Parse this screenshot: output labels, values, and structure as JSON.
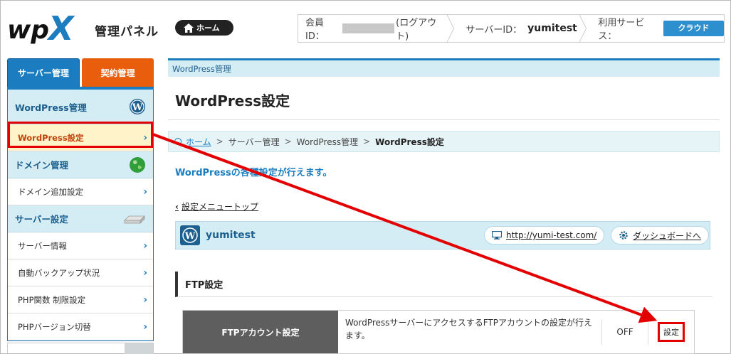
{
  "header": {
    "logo_text": "管理パネル",
    "home_label": "ホーム",
    "member_id_label": "会員ID：",
    "logout_label": "(ログアウト)",
    "server_id_label": "サーバーID：",
    "server_id_value": "yumitest",
    "service_label": "利用サービス：",
    "service_value": "クラウド"
  },
  "sidebar": {
    "tab_server": "サーバー管理",
    "tab_contract": "契約管理",
    "sections": [
      {
        "heading": "WordPress管理",
        "items": [
          "WordPress設定"
        ]
      },
      {
        "heading": "ドメイン管理",
        "items": [
          "ドメイン追加設定"
        ]
      },
      {
        "heading": "サーバー設定",
        "items": [
          "サーバー情報",
          "自動バックアップ状況",
          "PHP関数 制限設定",
          "PHPバージョン切替"
        ]
      }
    ]
  },
  "main": {
    "topbar": "WordPress管理",
    "title": "WordPress設定",
    "breadcrumb": {
      "home": "ホーム",
      "crumbs": [
        "サーバー管理",
        "WordPress管理"
      ],
      "current": "WordPress設定"
    },
    "description": "WordPressの各種設定が行えます。",
    "menu_top": "設定メニュートップ",
    "site": {
      "name": "yumitest",
      "url": "http://yumi-test.com/",
      "dashboard": "ダッシュボードへ"
    },
    "ftp": {
      "heading": "FTP設定",
      "label": "FTPアカウント設定",
      "description": "WordPressサーバーにアクセスするFTPアカウントの設定が行えます。",
      "status": "OFF",
      "button": "設定"
    }
  },
  "colors": {
    "brand_blue": "#1b7dbf",
    "accent_orange": "#e95e0d",
    "annotation_red": "#e30000"
  }
}
